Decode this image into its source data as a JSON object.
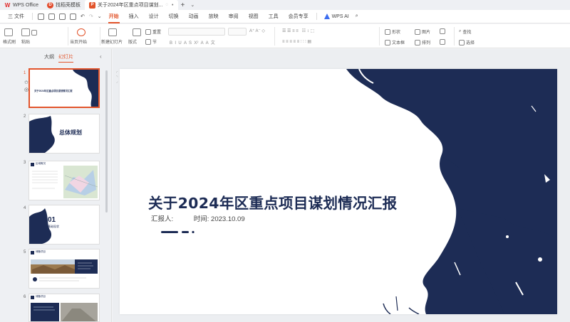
{
  "titlebar": {
    "tabs": [
      {
        "label": "WPS Office",
        "icon": "wps-logo-icon",
        "active": false
      },
      {
        "label": "找稻壳模板",
        "icon": "docer-icon",
        "active": false
      },
      {
        "label": "关于2024年区重点项目谋划...",
        "icon": "ppt-file-icon",
        "active": true
      }
    ],
    "new_tab": "+"
  },
  "menubar": {
    "file": "三 文件",
    "items": [
      "开始",
      "插入",
      "设计",
      "切换",
      "动画",
      "放映",
      "审阅",
      "视图",
      "工具",
      "会员专享"
    ],
    "active": "开始",
    "ai": "WPS AI"
  },
  "ribbon": {
    "format_painter": "格式刷",
    "paste": "粘贴",
    "from_start": "当页开始",
    "new_slide": "新建幻灯片",
    "layout": "版式",
    "section": "节",
    "reset": "重置",
    "shape": "形状",
    "picture": "图片",
    "textbox": "文本框",
    "arrange": "排列",
    "find": "查找",
    "select": "选择"
  },
  "left_panel": {
    "tab_outline": "大纲",
    "tab_slides": "幻灯片",
    "collapse": "‹",
    "slides": [
      {
        "num": "1",
        "title": "关于2024年区重点项目谋划情况汇报"
      },
      {
        "num": "2",
        "title": "总体规划"
      },
      {
        "num": "3",
        "title": "区域概况"
      },
      {
        "num": "4",
        "title": "01",
        "subtitle": "基础现状"
      },
      {
        "num": "5",
        "title": "储备项目"
      },
      {
        "num": "6",
        "title": "储备项目"
      }
    ]
  },
  "slide": {
    "title": "关于2024年区重点项目谋划情况汇报",
    "reporter_label": "汇报人:",
    "time_label": "时间: 2023.10.09"
  },
  "colors": {
    "accent": "#e2542b",
    "navy": "#1d2c55"
  }
}
